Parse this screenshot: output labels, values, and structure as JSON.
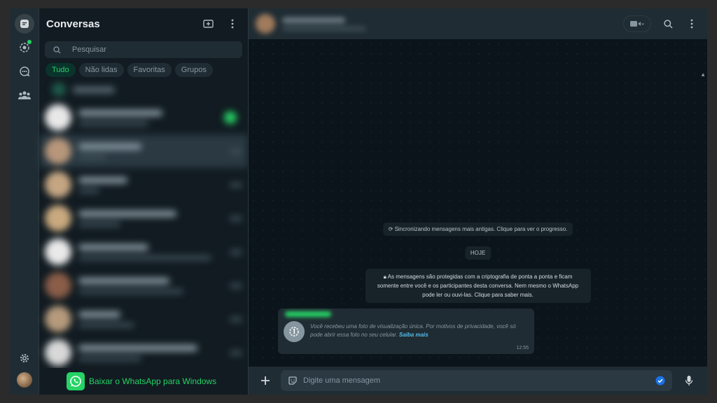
{
  "chat_list": {
    "title": "Conversas",
    "search_placeholder": "Pesquisar",
    "filters": [
      {
        "label": "Tudo",
        "active": true
      },
      {
        "label": "Não lidas",
        "active": false
      },
      {
        "label": "Favoritas",
        "active": false
      },
      {
        "label": "Grupos",
        "active": false
      }
    ]
  },
  "download_banner": {
    "label": "Baixar o WhatsApp para Windows"
  },
  "conversation": {
    "sync_notice": "Sincronizando mensagens mais antigas. Clique para ver o progresso.",
    "date_divider": "HOJE",
    "encryption_notice": "As mensagens são protegidas com a criptografia de ponta a ponta e ficam somente entre você e os participantes desta conversa. Nem mesmo o WhatsApp pode ler ou ouvi-las. Clique para saber mais.",
    "message": {
      "text": "Você recebeu uma foto de visualização única. Por motivos de privacidade, você só pode abrir essa foto no seu celular.",
      "link": "Saiba mais",
      "time": "12:55"
    }
  },
  "composer": {
    "placeholder": "Digite uma mensagem"
  },
  "colors": {
    "accent": "#25d366",
    "link": "#53bdeb",
    "panel": "#202c33",
    "background": "#111b21"
  }
}
